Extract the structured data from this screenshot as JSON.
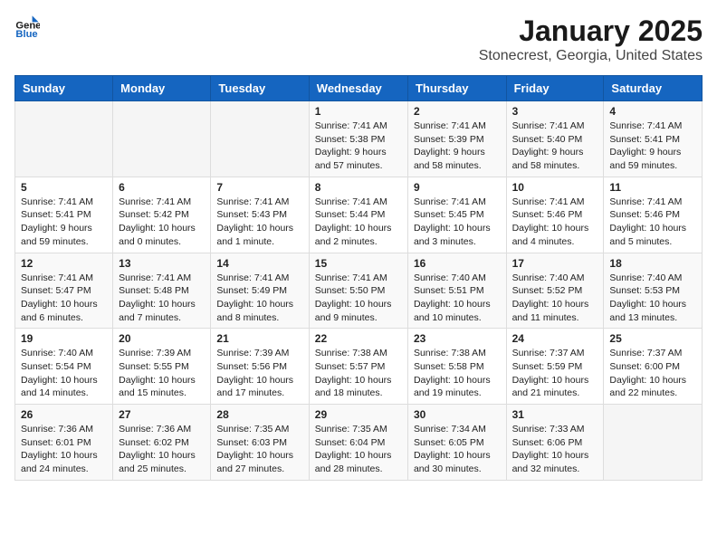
{
  "header": {
    "logo_general": "General",
    "logo_blue": "Blue",
    "month_title": "January 2025",
    "location": "Stonecrest, Georgia, United States"
  },
  "days_of_week": [
    "Sunday",
    "Monday",
    "Tuesday",
    "Wednesday",
    "Thursday",
    "Friday",
    "Saturday"
  ],
  "weeks": [
    [
      {
        "day": "",
        "info": ""
      },
      {
        "day": "",
        "info": ""
      },
      {
        "day": "",
        "info": ""
      },
      {
        "day": "1",
        "info": "Sunrise: 7:41 AM\nSunset: 5:38 PM\nDaylight: 9 hours\nand 57 minutes."
      },
      {
        "day": "2",
        "info": "Sunrise: 7:41 AM\nSunset: 5:39 PM\nDaylight: 9 hours\nand 58 minutes."
      },
      {
        "day": "3",
        "info": "Sunrise: 7:41 AM\nSunset: 5:40 PM\nDaylight: 9 hours\nand 58 minutes."
      },
      {
        "day": "4",
        "info": "Sunrise: 7:41 AM\nSunset: 5:41 PM\nDaylight: 9 hours\nand 59 minutes."
      }
    ],
    [
      {
        "day": "5",
        "info": "Sunrise: 7:41 AM\nSunset: 5:41 PM\nDaylight: 9 hours\nand 59 minutes."
      },
      {
        "day": "6",
        "info": "Sunrise: 7:41 AM\nSunset: 5:42 PM\nDaylight: 10 hours\nand 0 minutes."
      },
      {
        "day": "7",
        "info": "Sunrise: 7:41 AM\nSunset: 5:43 PM\nDaylight: 10 hours\nand 1 minute."
      },
      {
        "day": "8",
        "info": "Sunrise: 7:41 AM\nSunset: 5:44 PM\nDaylight: 10 hours\nand 2 minutes."
      },
      {
        "day": "9",
        "info": "Sunrise: 7:41 AM\nSunset: 5:45 PM\nDaylight: 10 hours\nand 3 minutes."
      },
      {
        "day": "10",
        "info": "Sunrise: 7:41 AM\nSunset: 5:46 PM\nDaylight: 10 hours\nand 4 minutes."
      },
      {
        "day": "11",
        "info": "Sunrise: 7:41 AM\nSunset: 5:46 PM\nDaylight: 10 hours\nand 5 minutes."
      }
    ],
    [
      {
        "day": "12",
        "info": "Sunrise: 7:41 AM\nSunset: 5:47 PM\nDaylight: 10 hours\nand 6 minutes."
      },
      {
        "day": "13",
        "info": "Sunrise: 7:41 AM\nSunset: 5:48 PM\nDaylight: 10 hours\nand 7 minutes."
      },
      {
        "day": "14",
        "info": "Sunrise: 7:41 AM\nSunset: 5:49 PM\nDaylight: 10 hours\nand 8 minutes."
      },
      {
        "day": "15",
        "info": "Sunrise: 7:41 AM\nSunset: 5:50 PM\nDaylight: 10 hours\nand 9 minutes."
      },
      {
        "day": "16",
        "info": "Sunrise: 7:40 AM\nSunset: 5:51 PM\nDaylight: 10 hours\nand 10 minutes."
      },
      {
        "day": "17",
        "info": "Sunrise: 7:40 AM\nSunset: 5:52 PM\nDaylight: 10 hours\nand 11 minutes."
      },
      {
        "day": "18",
        "info": "Sunrise: 7:40 AM\nSunset: 5:53 PM\nDaylight: 10 hours\nand 13 minutes."
      }
    ],
    [
      {
        "day": "19",
        "info": "Sunrise: 7:40 AM\nSunset: 5:54 PM\nDaylight: 10 hours\nand 14 minutes."
      },
      {
        "day": "20",
        "info": "Sunrise: 7:39 AM\nSunset: 5:55 PM\nDaylight: 10 hours\nand 15 minutes."
      },
      {
        "day": "21",
        "info": "Sunrise: 7:39 AM\nSunset: 5:56 PM\nDaylight: 10 hours\nand 17 minutes."
      },
      {
        "day": "22",
        "info": "Sunrise: 7:38 AM\nSunset: 5:57 PM\nDaylight: 10 hours\nand 18 minutes."
      },
      {
        "day": "23",
        "info": "Sunrise: 7:38 AM\nSunset: 5:58 PM\nDaylight: 10 hours\nand 19 minutes."
      },
      {
        "day": "24",
        "info": "Sunrise: 7:37 AM\nSunset: 5:59 PM\nDaylight: 10 hours\nand 21 minutes."
      },
      {
        "day": "25",
        "info": "Sunrise: 7:37 AM\nSunset: 6:00 PM\nDaylight: 10 hours\nand 22 minutes."
      }
    ],
    [
      {
        "day": "26",
        "info": "Sunrise: 7:36 AM\nSunset: 6:01 PM\nDaylight: 10 hours\nand 24 minutes."
      },
      {
        "day": "27",
        "info": "Sunrise: 7:36 AM\nSunset: 6:02 PM\nDaylight: 10 hours\nand 25 minutes."
      },
      {
        "day": "28",
        "info": "Sunrise: 7:35 AM\nSunset: 6:03 PM\nDaylight: 10 hours\nand 27 minutes."
      },
      {
        "day": "29",
        "info": "Sunrise: 7:35 AM\nSunset: 6:04 PM\nDaylight: 10 hours\nand 28 minutes."
      },
      {
        "day": "30",
        "info": "Sunrise: 7:34 AM\nSunset: 6:05 PM\nDaylight: 10 hours\nand 30 minutes."
      },
      {
        "day": "31",
        "info": "Sunrise: 7:33 AM\nSunset: 6:06 PM\nDaylight: 10 hours\nand 32 minutes."
      },
      {
        "day": "",
        "info": ""
      }
    ]
  ]
}
